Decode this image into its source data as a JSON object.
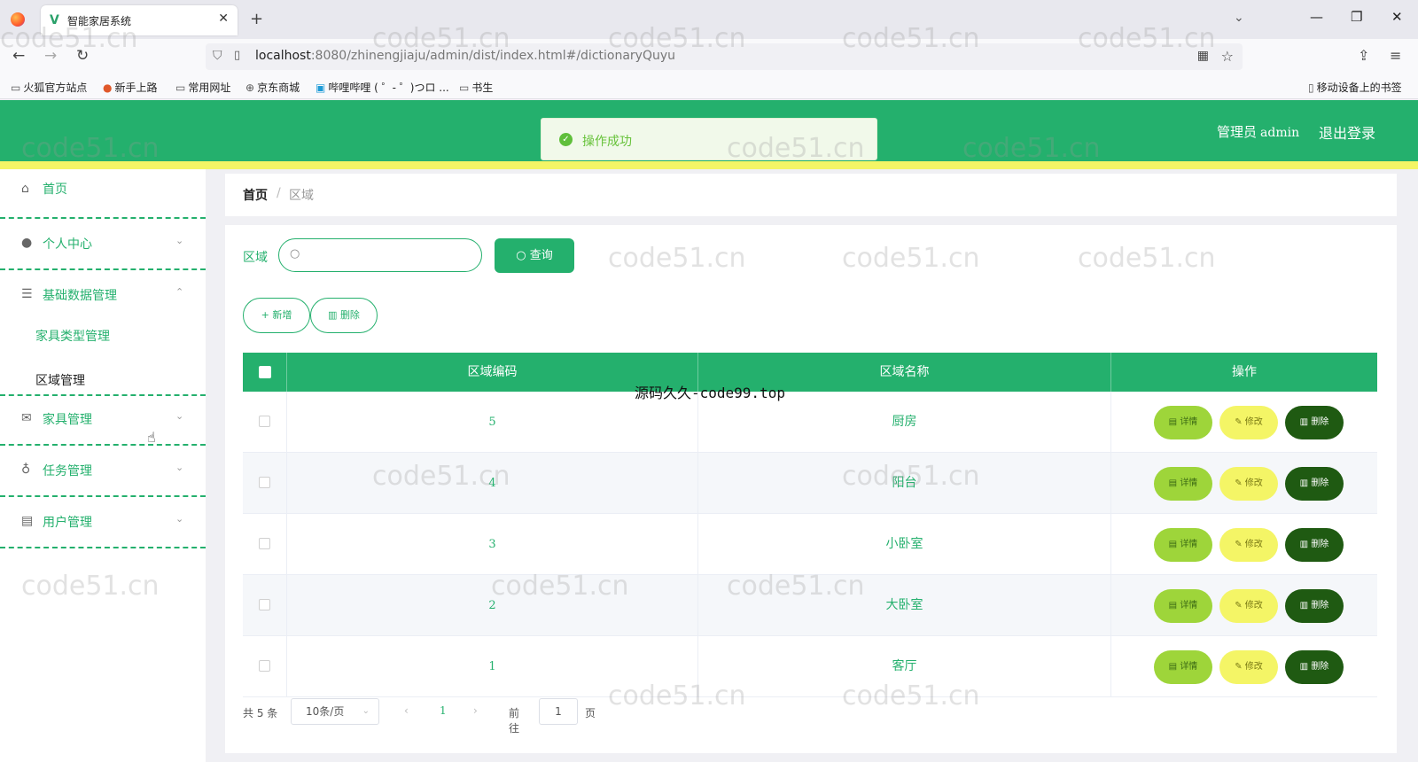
{
  "browser": {
    "tab_title": "智能家居系统",
    "tab_close": "✕",
    "new_tab": "+",
    "url_host": "localhost",
    "url_rest": ":8080/zhinengjiaju/admin/dist/index.html#/dictionaryQuyu",
    "bookmarks": [
      "火狐官方站点",
      "新手上路",
      "常用网址",
      "京东商城",
      "哔哩哔哩 ( ゜- ゜)つロ ...",
      "书生"
    ],
    "mobile_bookmarks": "移动设备上的书签"
  },
  "header": {
    "user_role": "管理员",
    "user_name": "admin",
    "logout": "退出登录",
    "toast": "操作成功"
  },
  "sidebar": {
    "items": [
      {
        "label": "首页",
        "icon": "home-icon"
      },
      {
        "label": "个人中心",
        "icon": "user-icon"
      },
      {
        "label": "基础数据管理",
        "icon": "sliders-icon"
      },
      {
        "label": "家具管理",
        "icon": "mail-icon"
      },
      {
        "label": "任务管理",
        "icon": "mic-icon"
      },
      {
        "label": "用户管理",
        "icon": "card-icon"
      }
    ],
    "sub_items": [
      "家具类型管理",
      "区域管理"
    ]
  },
  "breadcrumb": {
    "home": "首页",
    "separator": "/",
    "current": "区域"
  },
  "search": {
    "label": "区域",
    "placeholder": "",
    "button": "查询"
  },
  "actions": {
    "add": "新增",
    "delete": "删除"
  },
  "table": {
    "columns": [
      "区域编码",
      "区域名称",
      "操作"
    ],
    "rows": [
      {
        "code": "5",
        "name": "厨房"
      },
      {
        "code": "4",
        "name": "阳台"
      },
      {
        "code": "3",
        "name": "小卧室"
      },
      {
        "code": "2",
        "name": "大卧室"
      },
      {
        "code": "1",
        "name": "客厅"
      }
    ],
    "op_detail": "详情",
    "op_edit": "修改",
    "op_delete": "删除"
  },
  "pagination": {
    "total": "共 5 条",
    "page_size": "10条/页",
    "current_page": "1",
    "goto_label": "前往",
    "goto_value": "1",
    "page_unit": "页"
  },
  "overlay_caption": "源码久久-code99.top",
  "watermark": "code51.cn",
  "colors": {
    "primary": "#24b06d",
    "accent_yellow": "#f4f566",
    "detail_green": "#9ed53a",
    "delete_dark": "#1f5a12"
  }
}
